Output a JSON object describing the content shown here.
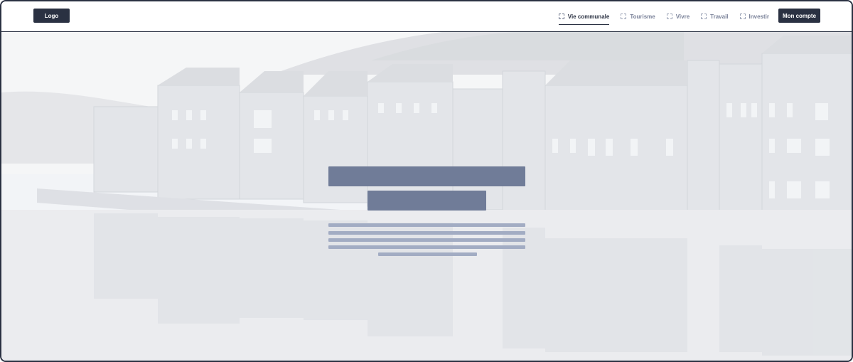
{
  "header": {
    "logo_label": "Logo",
    "nav": [
      {
        "label": "Vie communale",
        "active": true
      },
      {
        "label": "Tourisme",
        "active": false
      },
      {
        "label": "Vivre",
        "active": false
      },
      {
        "label": "Travail",
        "active": false
      },
      {
        "label": "Investir",
        "active": false
      }
    ],
    "account_label": "Mon compte"
  },
  "colors": {
    "primary": "#2a3142",
    "nav_inactive": "#7a8299",
    "skeleton_dark": "#707c98",
    "skeleton_light": "#a2acc3"
  },
  "hero": {
    "image_description_icon": "town-riverside-photo"
  }
}
